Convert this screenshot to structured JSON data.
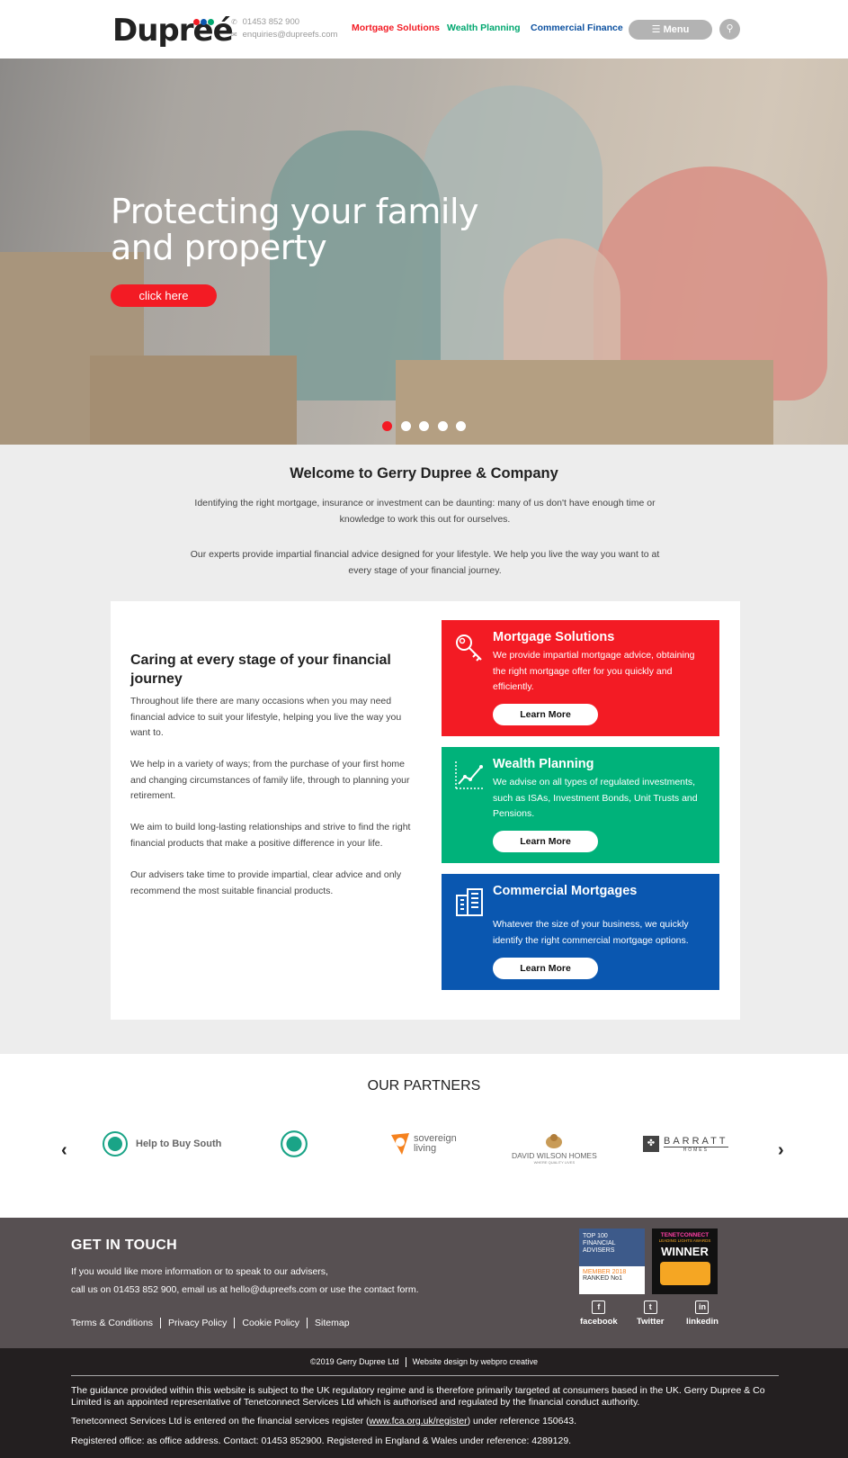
{
  "header": {
    "logo": "Dupreé",
    "phone": "01453 852 900",
    "email": "enquiries@dupreefs.com",
    "nav": [
      {
        "label": "Mortgage Solutions",
        "color": "#f31b24"
      },
      {
        "label": "Wealth Planning",
        "color": "#00a76f"
      },
      {
        "label": "Commercial Finance",
        "color": "#0a4f9f"
      }
    ],
    "menu_label": "Menu"
  },
  "hero": {
    "title": "Protecting your family and property",
    "button": "click here",
    "slides": 5,
    "active_slide": 1
  },
  "welcome": {
    "title": "Welcome to Gerry Dupree & Company",
    "p1": "Identifying the right mortgage, insurance or investment can be daunting: many of us don't have enough time or knowledge to work this out for ourselves.",
    "p2": "Our experts provide impartial financial advice designed for your lifestyle. We help you live the way you want to at every stage of your financial journey."
  },
  "caring": {
    "title": "Caring at every stage of your financial journey",
    "paragraphs": [
      "Throughout life there are many occasions when you may need financial advice to suit your lifestyle, helping you live the way you want to.",
      "We help in a variety of ways; from the purchase of your first home and changing circumstances of family life, through to planning your retirement.",
      "We aim to build long-lasting relationships and strive to find the right financial products that make a positive difference in your life.",
      "Our advisers take time to provide impartial, clear advice and only recommend the most suitable financial products."
    ]
  },
  "services": [
    {
      "title": "Mortgage Solutions",
      "desc": "We provide impartial mortgage advice, obtaining the right mortgage offer for you quickly and efficiently.",
      "button": "Learn More",
      "color": "#f31b24",
      "icon": "key-icon"
    },
    {
      "title": "Wealth Planning",
      "desc": "We advise on all types of regulated investments, such as ISAs, Investment Bonds, Unit Trusts and Pensions.",
      "button": "Learn More",
      "color": "#00b27a",
      "icon": "growth-chart-icon"
    },
    {
      "title": "Commercial Mortgages",
      "desc": "Whatever the size of your business, we quickly identify the right commercial mortgage options.",
      "button": "Learn More",
      "color": "#0a57b0",
      "icon": "buildings-icon"
    }
  ],
  "partners": {
    "title": "OUR PARTNERS",
    "logos": [
      "Help to Buy South",
      "sovereign living",
      "DAVID WILSON HOMES",
      "WHERE QUALITY LIVES",
      "BARRATT",
      "HOMES"
    ]
  },
  "footer": {
    "title": "GET IN TOUCH",
    "line1": "If you would like more information or to speak to our advisers,",
    "line2": "call us on 01453 852 900, email us at hello@dupreefs.com or use the contact form.",
    "links": [
      "Terms & Conditions",
      "Privacy Policy",
      "Cookie Policy",
      "Sitemap"
    ],
    "award1": {
      "top": "TOP 100",
      "sub": "FINANCIAL ADVISERS",
      "member": "MEMBER 2018",
      "rank": "RANKED No1"
    },
    "award2": {
      "brand": "TENETCONNECT",
      "sub": "LEADING LIGHTS AWARDS",
      "main": "WINNER"
    },
    "social": [
      "facebook",
      "Twitter",
      "linkedin"
    ]
  },
  "bottom": {
    "copyright": "©2019 Gerry Dupree Ltd",
    "credit": "Website design by webpro creative",
    "legal1": "The guidance provided within this website is subject to the UK regulatory regime and is therefore primarily targeted at consumers based in the UK. Gerry Dupree & Co Limited is an appointed representative of Tenetconnect Services Ltd which is authorised and regulated by the financial conduct authority.",
    "legal2_pre": "Tenetconnect Services Ltd is entered on the financial services register (",
    "legal2_link": "www.fca.org.uk/register",
    "legal2_post": ") under reference 150643.",
    "legal3": "Registered office: as office address. Contact: 01453 852900. Registered in England & Wales under reference: 4289129."
  }
}
